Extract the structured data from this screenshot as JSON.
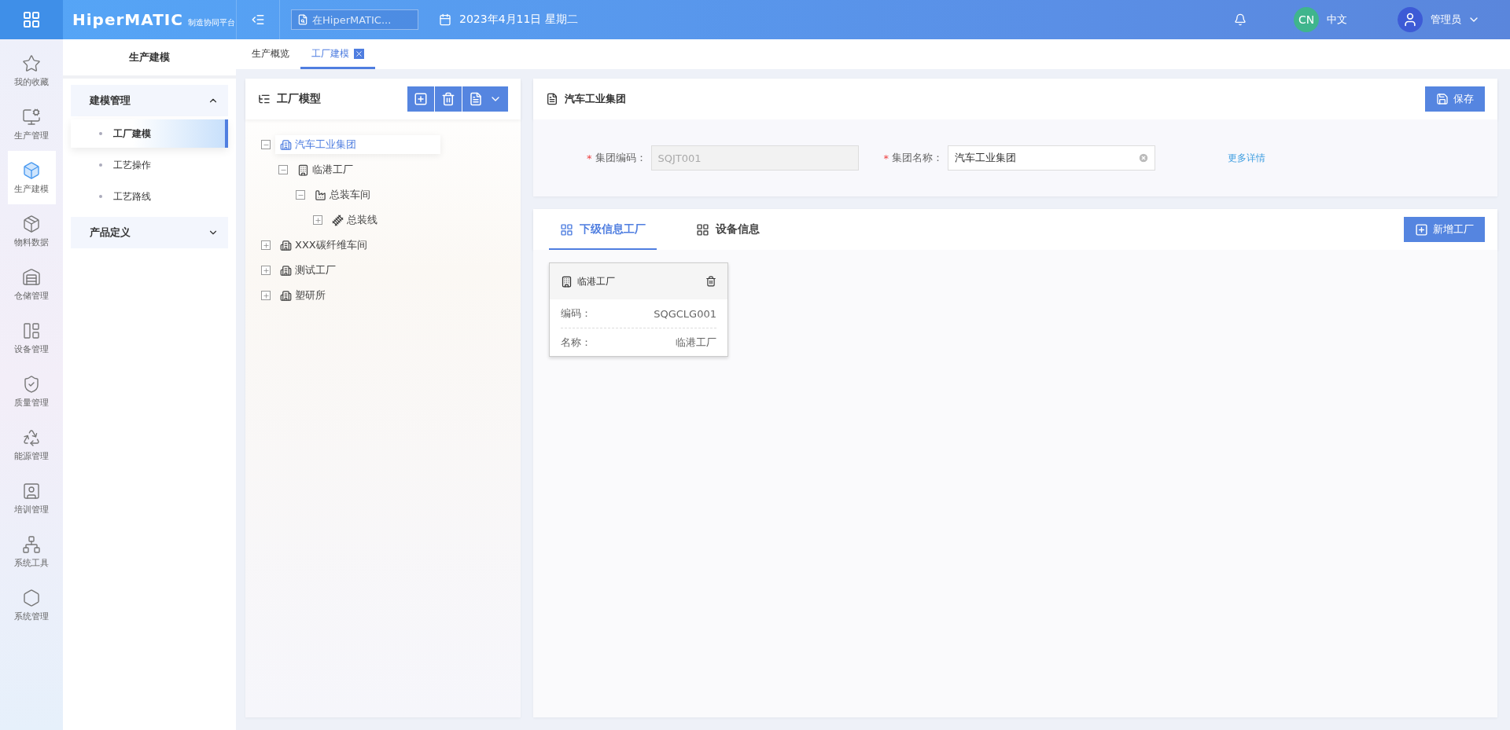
{
  "topbar": {
    "logo": "HiperMATIC",
    "subtitle": "制造协同平台",
    "search": {
      "placeholder": "在HiperMATIC..."
    },
    "date": "2023年4月11日 星期二",
    "lang_badge": "CN",
    "lang": "中文",
    "user": "管理员"
  },
  "rail": [
    {
      "label": "我的收藏",
      "selected": false
    },
    {
      "label": "生产管理",
      "selected": false
    },
    {
      "label": "生产建模",
      "selected": true
    },
    {
      "label": "物料数据",
      "selected": false
    },
    {
      "label": "仓储管理",
      "selected": false
    },
    {
      "label": "设备管理",
      "selected": false
    },
    {
      "label": "质量管理",
      "selected": false
    },
    {
      "label": "能源管理",
      "selected": false
    },
    {
      "label": "培训管理",
      "selected": false
    },
    {
      "label": "系统工具",
      "selected": false
    },
    {
      "label": "系统管理",
      "selected": false
    }
  ],
  "sidebar": {
    "title": "生产建模",
    "groups": [
      {
        "label": "建模管理",
        "expanded": true,
        "children": [
          {
            "label": "工厂建模",
            "selected": true
          },
          {
            "label": "工艺操作",
            "selected": false
          },
          {
            "label": "工艺路线",
            "selected": false
          }
        ]
      },
      {
        "label": "产品定义",
        "expanded": false
      }
    ]
  },
  "page_tabs": [
    {
      "label": "生产概览",
      "selected": false,
      "closable": false
    },
    {
      "label": "工厂建模",
      "selected": true,
      "closable": true
    }
  ],
  "tree": {
    "title": "工厂模型",
    "nodes": [
      {
        "label": "汽车工业集团",
        "kind": "group",
        "expanded": true,
        "selected": true,
        "children": [
          {
            "label": "临港工厂",
            "kind": "factory",
            "expanded": true,
            "selected": false,
            "children": [
              {
                "label": "总装车间",
                "kind": "workshop",
                "expanded": true,
                "selected": false,
                "children": [
                  {
                    "label": "总装线",
                    "kind": "line",
                    "expanded": false,
                    "selected": false
                  }
                ]
              }
            ]
          }
        ]
      },
      {
        "label": "XXX碳纤维车间",
        "kind": "group",
        "expanded": false,
        "selected": false
      },
      {
        "label": "测试工厂",
        "kind": "group",
        "expanded": false,
        "selected": false
      },
      {
        "label": "塑研所",
        "kind": "group",
        "expanded": false,
        "selected": false
      }
    ]
  },
  "detail": {
    "title": "汽车工业集团",
    "save": "保存",
    "fields": [
      {
        "required_mark": "*",
        "label": "集团编码：",
        "value": "SQJT001",
        "disabled": true
      },
      {
        "required_mark": "*",
        "label": "集团名称：",
        "value": "汽车工业集团",
        "disabled": false
      }
    ],
    "more_link": "更多详情"
  },
  "sub": {
    "tabs": [
      {
        "label": "下级信息工厂",
        "selected": true
      },
      {
        "label": "设备信息",
        "selected": false
      }
    ],
    "add_button": "新增工厂",
    "cards": [
      {
        "title": "临港工厂",
        "rows": [
          {
            "label": "编码：",
            "value": "SQGCLG001"
          },
          {
            "label": "名称：",
            "value": "临港工厂"
          }
        ]
      }
    ]
  }
}
